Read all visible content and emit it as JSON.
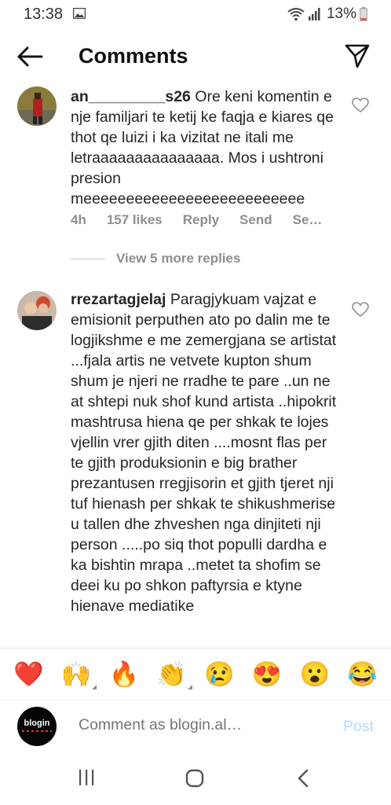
{
  "status_bar": {
    "time": "13:38",
    "battery": "13%",
    "icons": [
      "gallery-icon",
      "wifi-icon",
      "signal-icon",
      "battery-icon"
    ]
  },
  "header": {
    "title": "Comments",
    "back_icon": "arrow-left-icon",
    "share_icon": "paper-plane-icon"
  },
  "comments": [
    {
      "username": "an_________s26",
      "text": "Ore keni komentin e nje familjari te ketij ke faqja e kiares qe thot qe luizi i ka vizitat ne itali me letraaaaaaaaaaaaaaa. Mos i ushtroni presion meeeeeeeeeeeeeeeeeeeeeeeeee",
      "time": "4h",
      "likes": "157 likes",
      "reply": "Reply",
      "send": "Send",
      "more": "Se…",
      "view_replies": "View 5 more replies"
    },
    {
      "username": "rrezartagjelaj",
      "text": "Paragjykuam vajzat e emisionit perputhen ato po dalin me te logjikshme e me zemergjana se artistat ...fjala artis ne vetvete kupton shum shum je njeri ne rradhe te pare ..un ne at shtepi nuk shof kund artista ..hipokrit mashtrusa hiena qe per shkak te lojes vjellin vrer gjith diten ....mosnt flas per te gjith produksionin e big brather prezantusen rregjisorin et gjith tjeret nji tuf hienash per shkak te shikushmerise u tallen dhe zhveshen nga dinjiteti nji person .....po siq thot populli dardha e ka bishtin mrapa ..metet ta shofim se deei ku po shkon paftyrsia e ktyne hienave mediatike"
    }
  ],
  "emoji_bar": {
    "emojis": [
      "❤️",
      "🙌",
      "🔥",
      "👏",
      "😢",
      "😍",
      "😮",
      "😂"
    ]
  },
  "composer": {
    "placeholder": "Comment as blogin.al…",
    "post_label": "Post",
    "avatar_text": "blogin"
  },
  "nav_bar": {
    "icons": [
      "recents-icon",
      "home-icon",
      "back-icon"
    ]
  },
  "colors": {
    "text": "#262626",
    "meta": "#8e8e8e",
    "post_disabled": "#b3dbff"
  }
}
